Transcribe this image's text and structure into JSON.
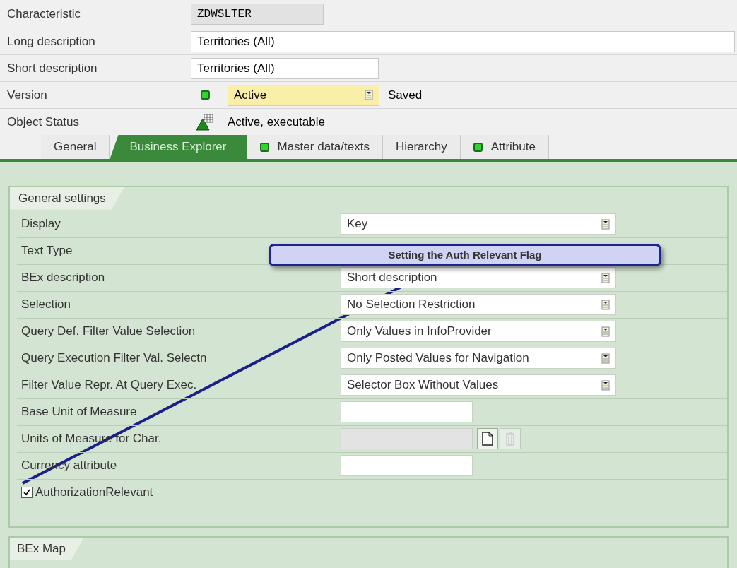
{
  "header": [
    {
      "label": "Characteristic",
      "kind": "readonly",
      "value": "ZDWSLTER"
    },
    {
      "label": "Long description",
      "kind": "wide",
      "value": "Territories (All)"
    },
    {
      "label": "Short description",
      "kind": "input",
      "value": "Territories (All)"
    },
    {
      "label": "Version",
      "kind": "version",
      "value": "Active",
      "note": "Saved"
    },
    {
      "label": "Object Status",
      "kind": "status",
      "value": "Active, executable"
    }
  ],
  "tabs": [
    {
      "label": "General",
      "selected": false,
      "light": false
    },
    {
      "label": "Business Explorer",
      "selected": true,
      "light": false
    },
    {
      "label": "Master data/texts",
      "selected": false,
      "light": true
    },
    {
      "label": "Hierarchy",
      "selected": false,
      "light": false
    },
    {
      "label": "Attribute",
      "selected": false,
      "light": true
    }
  ],
  "general_settings": {
    "title": "General settings",
    "rows": [
      {
        "label": "Display",
        "kind": "dropdown",
        "value": "Key"
      },
      {
        "label": "Text Type",
        "kind": "hidden"
      },
      {
        "label": "BEx description",
        "kind": "dropdown",
        "value": "Short description"
      },
      {
        "label": "Selection",
        "kind": "dropdown",
        "value": "No Selection Restriction"
      },
      {
        "label": "Query Def. Filter Value Selection",
        "kind": "dropdown",
        "value": "Only Values in InfoProvider"
      },
      {
        "label": "Query Execution Filter Val. Selectn",
        "kind": "dropdown",
        "value": "Only Posted Values for Navigation"
      },
      {
        "label": "Filter Value Repr. At Query Exec.",
        "kind": "dropdown",
        "value": "Selector Box Without Values"
      },
      {
        "label": "Base Unit of Measure",
        "kind": "input"
      },
      {
        "label": "Units of Measure for Char.",
        "kind": "disabled"
      },
      {
        "label": "Currency attribute",
        "kind": "input"
      },
      {
        "label": "AuthorizationRelevant",
        "kind": "checkbox",
        "checked": true
      }
    ]
  },
  "callout": "Setting the Auth Relevant Flag",
  "bex_map": {
    "title": "BEx Map"
  }
}
